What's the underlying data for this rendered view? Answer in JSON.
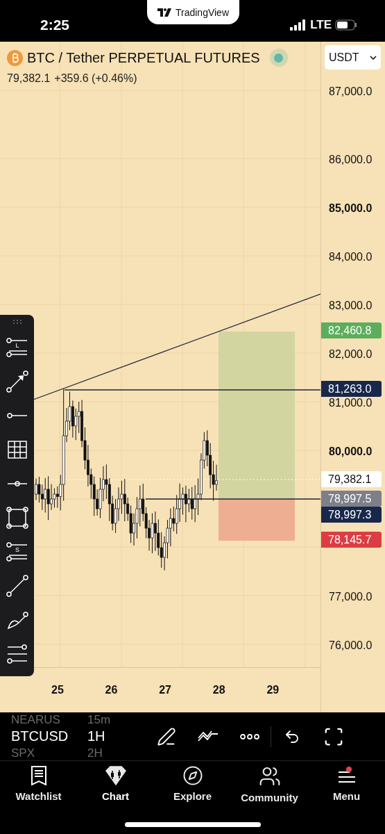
{
  "status_bar": {
    "time": "2:25",
    "network": "LTE"
  },
  "app_pill": {
    "name": "TradingView"
  },
  "symbol": {
    "title": "BTC / Tether PERPETUAL FUTURES",
    "price": "79,382.1",
    "change": "+359.6 (+0.46%)"
  },
  "currency": {
    "value": "USDT"
  },
  "price_axis": [
    {
      "label": "87,000.0",
      "bold": false
    },
    {
      "label": "86,000.0",
      "bold": false
    },
    {
      "label": "85,000.0",
      "bold": true
    },
    {
      "label": "84,000.0",
      "bold": false
    },
    {
      "label": "83,000.0",
      "bold": false
    },
    {
      "label": "82,000.0",
      "bold": false
    },
    {
      "label": "81,000.0",
      "bold": false
    },
    {
      "label": "80,000.0",
      "bold": true
    },
    {
      "label": "77,000.0",
      "bold": false
    },
    {
      "label": "76,000.0",
      "bold": false
    }
  ],
  "price_badges": [
    {
      "label": "82,460.8",
      "color": "#5cae5c"
    },
    {
      "label": "81,263.0",
      "color": "#17284b"
    },
    {
      "label": "79,382.1",
      "color": "#ffffff"
    },
    {
      "label": "78,997.5",
      "color": "#7d8088"
    },
    {
      "label": "78,997.3",
      "color": "#17284b"
    },
    {
      "label": "78,145.7",
      "color": "#dc3d45"
    }
  ],
  "time_axis": [
    "25",
    "26",
    "27",
    "28",
    "29"
  ],
  "drawing_tools": [
    {
      "kind": "levels",
      "label": "L"
    },
    {
      "kind": "arrow"
    },
    {
      "kind": "ray"
    },
    {
      "kind": "grid"
    },
    {
      "kind": "hline"
    },
    {
      "kind": "rectangle"
    },
    {
      "kind": "levels",
      "label": "S"
    },
    {
      "kind": "trendline"
    },
    {
      "kind": "brush"
    },
    {
      "kind": "list"
    }
  ],
  "symbol_picker": [
    {
      "symbol": "NEARUS",
      "interval": "15m",
      "selected": false
    },
    {
      "symbol": "BTCUSD",
      "interval": "1H",
      "selected": true
    },
    {
      "symbol": "SPX",
      "interval": "2H",
      "selected": false
    }
  ],
  "tabs": [
    {
      "label": "Watchlist",
      "selected": false,
      "notification": false
    },
    {
      "label": "Chart",
      "selected": true,
      "notification": false
    },
    {
      "label": "Explore",
      "selected": false,
      "notification": false
    },
    {
      "label": "Community",
      "selected": false,
      "notification": false
    },
    {
      "label": "Menu",
      "selected": false,
      "notification": true
    }
  ]
}
